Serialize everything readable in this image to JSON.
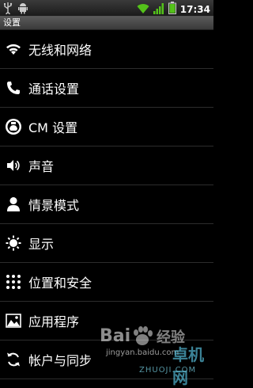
{
  "status_bar": {
    "time": "17:34",
    "icons": [
      "usb-icon",
      "android-debug-icon",
      "wifi-icon",
      "signal-icon",
      "battery-icon"
    ]
  },
  "title": "设置",
  "settings": [
    {
      "label": "无线和网络",
      "icon": "wifi-icon"
    },
    {
      "label": "通话设置",
      "icon": "phone-icon"
    },
    {
      "label": "CM 设置",
      "icon": "cyanogenmod-icon"
    },
    {
      "label": "声音",
      "icon": "speaker-icon"
    },
    {
      "label": "情景模式",
      "icon": "person-icon"
    },
    {
      "label": "显示",
      "icon": "brightness-icon"
    },
    {
      "label": "位置和安全",
      "icon": "lock-pattern-icon"
    },
    {
      "label": "应用程序",
      "icon": "applications-icon"
    },
    {
      "label": "帐户与同步",
      "icon": "sync-icon"
    }
  ],
  "watermark": {
    "baidu": "Bai",
    "jingyan": "经验",
    "site": "jingyan.baidu.com",
    "zhuo": "卓机网",
    "zhuoji": "ZHUOJI.COM"
  }
}
